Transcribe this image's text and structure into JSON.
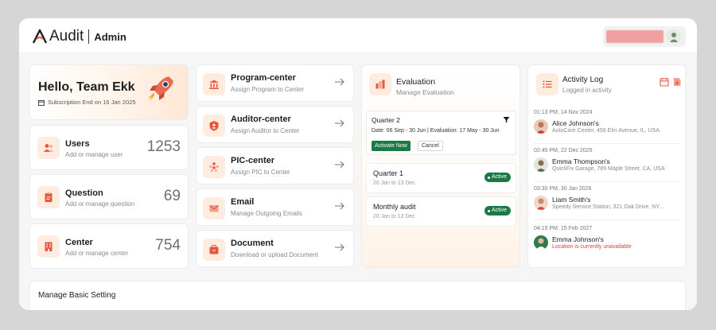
{
  "header": {
    "logo_text": "Audit",
    "logo_suffix": "Admin"
  },
  "greeting": {
    "title": "Hello, Team Ekk",
    "subscription": "Subscription End on 16 Jan 2025"
  },
  "stats": [
    {
      "title": "Users",
      "subtitle": "Add or manage user",
      "value": "1253",
      "icon": "users-icon"
    },
    {
      "title": "Question",
      "subtitle": "Add or manage question",
      "value": "69",
      "icon": "clipboard-icon"
    },
    {
      "title": "Center",
      "subtitle": "Add or manage center",
      "value": "754",
      "icon": "building-icon"
    }
  ],
  "nav_cards": [
    {
      "title": "Program-center",
      "subtitle": "Assign Program to Center",
      "icon": "bank-icon"
    },
    {
      "title": "Auditor-center",
      "subtitle": "Assign Auditor to Center",
      "icon": "shield-icon"
    },
    {
      "title": "PIC-center",
      "subtitle": "Assign PIC to Center",
      "icon": "people-icon"
    },
    {
      "title": "Email",
      "subtitle": "Manage Outgoing Emails",
      "icon": "mail-icon"
    },
    {
      "title": "Document",
      "subtitle": "Download or upload Document",
      "icon": "document-icon"
    }
  ],
  "evaluation": {
    "title": "Evaluation",
    "subtitle": "Manage Evaluation",
    "current": {
      "title": "Quarter 2",
      "dates": "Date: 06 Sep - 30 Jun | Evaluation: 17 May - 30 Jun",
      "activate_label": "Activate Now",
      "cancel_label": "Cancel"
    },
    "items": [
      {
        "title": "Quarter 1",
        "range": "20 Jan to 13 Dec",
        "status": "Active"
      },
      {
        "title": "Monthly audit",
        "range": "20 Jan to 13 Dec",
        "status": "Active"
      }
    ]
  },
  "activity": {
    "title": "Activity Log",
    "subtitle": "Logged in activity",
    "entries": [
      {
        "time": "01:13 PM, 14 Nov 2024",
        "name": "Alice Johnson's",
        "location": "AutoCare Center, 456 Elm Avenue, IL, USA"
      },
      {
        "time": "02:45 PM, 22 Dec 2025",
        "name": "Emma Thompson's",
        "location": "QuickFix Garage, 789 Maple Street, CA, USA"
      },
      {
        "time": "03:30 PM, 30 Jan 2026",
        "name": "Liam Smith's",
        "location": "Speedy Service Station, 321 Oak Drive, NY..."
      },
      {
        "time": "04:15 PM, 15 Feb 2027",
        "name": "Emma Johnson's",
        "location": "Location is currently unavailable"
      }
    ]
  },
  "settings": {
    "title": "Manage Basic Setting"
  },
  "colors": {
    "accent": "#e8573a",
    "active_green": "#1b7a44",
    "warning_text": "#d9413a"
  }
}
